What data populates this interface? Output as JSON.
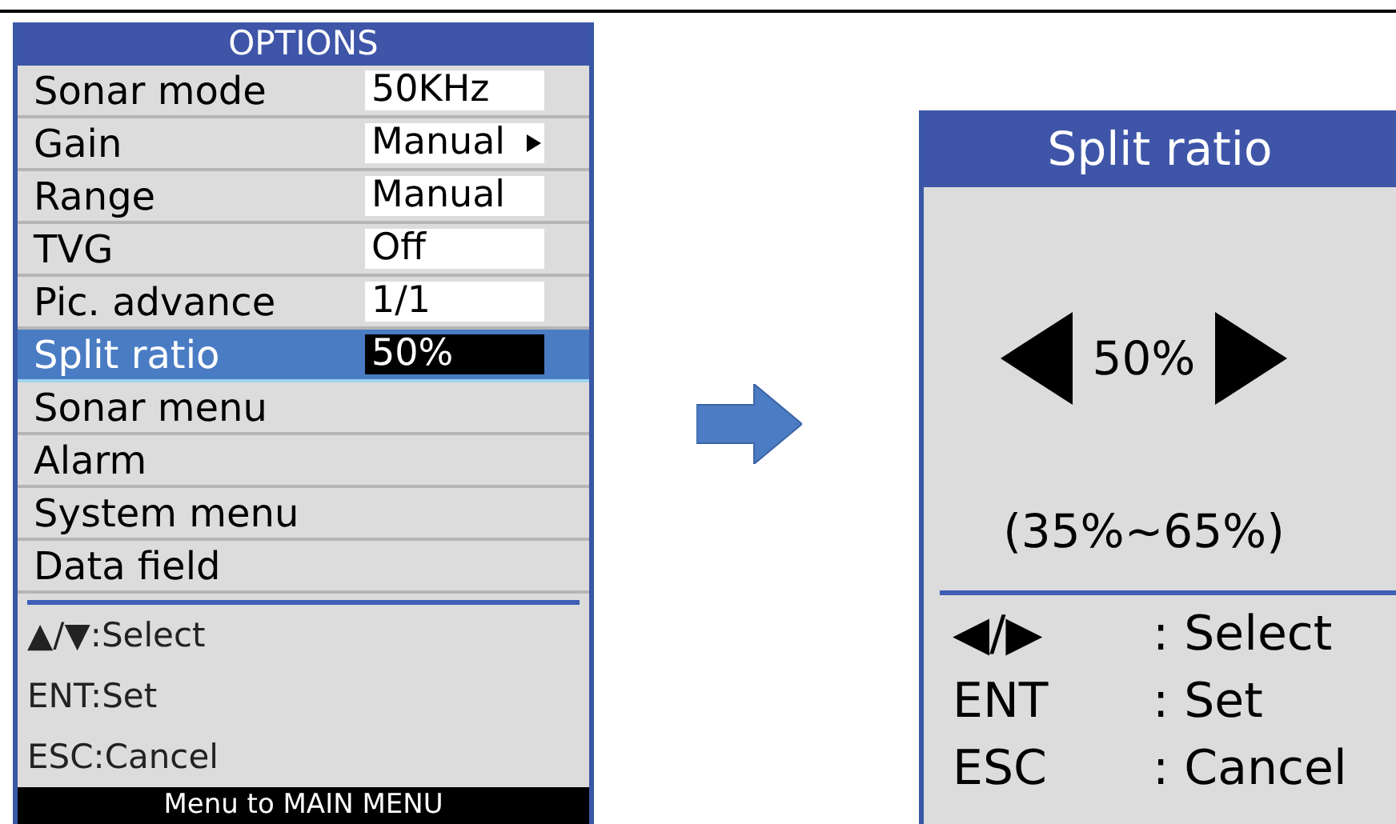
{
  "options_menu": {
    "title": "OPTIONS",
    "items": [
      {
        "label": "Sonar mode",
        "value": "50KHz",
        "submenu": false,
        "selected": false
      },
      {
        "label": "Gain",
        "value": "Manual",
        "submenu": true,
        "selected": false
      },
      {
        "label": "Range",
        "value": "Manual",
        "submenu": false,
        "selected": false
      },
      {
        "label": "TVG",
        "value": "Off",
        "submenu": false,
        "selected": false
      },
      {
        "label": "Pic. advance",
        "value": "1/1",
        "submenu": false,
        "selected": false
      },
      {
        "label": "Split ratio",
        "value": "50%",
        "submenu": false,
        "selected": true
      },
      {
        "label": "Sonar menu",
        "selected": false
      },
      {
        "label": "Alarm",
        "selected": false
      },
      {
        "label": "System menu",
        "selected": false
      },
      {
        "label": "Data field",
        "selected": false
      }
    ],
    "hints": [
      "▲/▼:Select",
      "ENT:Set",
      "ESC:Cancel"
    ],
    "footer": "Menu to MAIN MENU"
  },
  "split_ratio_dialog": {
    "title": "Split ratio",
    "value": "50%",
    "range": "(35%~65%)",
    "hints": [
      {
        "key": "◀/▶",
        "action": ": Select"
      },
      {
        "key": "ENT",
        "action": ": Set"
      },
      {
        "key": "ESC",
        "action": ": Cancel"
      }
    ]
  }
}
